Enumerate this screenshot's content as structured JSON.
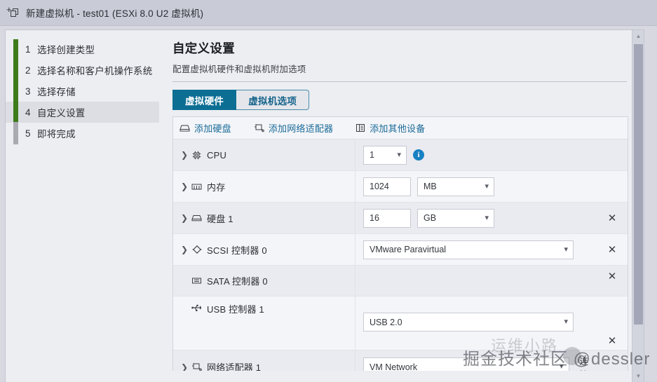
{
  "window": {
    "title": "新建虚拟机 - test01 (ESXi 8.0 U2 虚拟机)",
    "icon": "new-vm-icon"
  },
  "wizard": {
    "steps": [
      {
        "num": "1",
        "label": "选择创建类型"
      },
      {
        "num": "2",
        "label": "选择名称和客户机操作系统"
      },
      {
        "num": "3",
        "label": "选择存储"
      },
      {
        "num": "4",
        "label": "自定义设置"
      },
      {
        "num": "5",
        "label": "即将完成"
      }
    ],
    "active_index": 3,
    "progress_color": "#3e7b1a",
    "rail_color": "#a9aab2"
  },
  "page": {
    "title": "自定义设置",
    "subtitle": "配置虚拟机硬件和虚拟机附加选项"
  },
  "tabs": [
    {
      "label": "虚拟硬件",
      "active": true
    },
    {
      "label": "虚拟机选项",
      "active": false
    }
  ],
  "toolbar": {
    "add_disk": "添加硬盘",
    "add_nic": "添加网络适配器",
    "add_other": "添加其他设备"
  },
  "hardware": {
    "cpu": {
      "label": "CPU",
      "value": "1",
      "info": "i"
    },
    "memory": {
      "label": "内存",
      "value": "1024",
      "unit": "MB"
    },
    "disk": {
      "label": "硬盘 1",
      "value": "16",
      "unit": "GB",
      "remove": "✕"
    },
    "scsi": {
      "label": "SCSI 控制器 0",
      "value": "VMware Paravirtual",
      "remove": "✕"
    },
    "sata": {
      "label": "SATA 控制器 0",
      "remove": "✕"
    },
    "usb": {
      "label": "USB 控制器 1",
      "value": "USB 2.0",
      "remove": "✕"
    },
    "nic": {
      "label": "网络适配器 1",
      "value": "VM Network",
      "connect_label": "连接"
    }
  },
  "watermark": {
    "main": "掘金技术社区 @dessler",
    "back": "运维小路"
  },
  "colors": {
    "accent_tab": "#0d6e93",
    "link": "#1a6b99",
    "progress": "#3e7b1a",
    "info": "#1781c2"
  }
}
